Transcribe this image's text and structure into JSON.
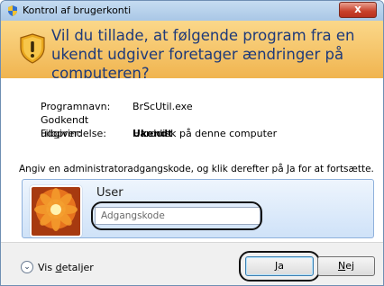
{
  "window": {
    "title": "Kontrol af brugerkonti",
    "close_label": "x"
  },
  "banner": {
    "question": "Vil du tillade, at følgende program fra en ukendt udgiver foretager ændringer på computeren?",
    "icon": "uac-shield-icon"
  },
  "details": [
    {
      "label": "Programnavn:",
      "value": "BrScUtil.exe",
      "bold": false
    },
    {
      "label": "Godkendt udgiver:",
      "value": "Ukendt",
      "bold": true
    },
    {
      "label": "Filoprindelse:",
      "value": "Harddisk på denne computer",
      "bold": false
    }
  ],
  "instruction": "Angiv en administratoradgangskode, og klik derefter på Ja for at fortsætte.",
  "credential": {
    "user_name": "User",
    "password_placeholder": "Adgangskode",
    "password_value": ""
  },
  "footer": {
    "show_details_prefix": "Vis ",
    "show_details_accel": "d",
    "show_details_suffix": "etaljer",
    "yes_accel": "J",
    "yes_rest": "a",
    "no_accel": "N",
    "no_rest": "ej"
  },
  "colors": {
    "banner_top": "#fbd88a",
    "banner_bottom": "#f0b44f",
    "banner_text": "#1e3a7a",
    "close_button": "#c8402a",
    "tile_border": "#8fb1dc"
  }
}
